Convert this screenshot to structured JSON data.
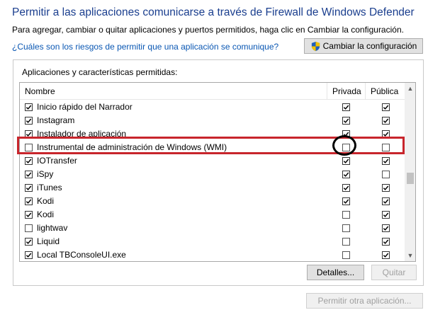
{
  "header": {
    "title": "Permitir a las aplicaciones comunicarse a través de Firewall de Windows Defender",
    "subtitle": "Para agregar, cambiar o quitar aplicaciones y puertos permitidos, haga clic en Cambiar la configuración.",
    "risk_link": "¿Cuáles son los riesgos de permitir que una aplicación se comunique?",
    "change_settings_label": "Cambiar la configuración"
  },
  "apps_group": {
    "label": "Aplicaciones y características permitidas:",
    "columns": {
      "name": "Nombre",
      "private": "Privada",
      "public": "Pública"
    },
    "rows": [
      {
        "name": "Inicio rápido del Narrador",
        "enabled": true,
        "private": true,
        "public": true
      },
      {
        "name": "Instagram",
        "enabled": true,
        "private": true,
        "public": true
      },
      {
        "name": "Instalador de aplicación",
        "enabled": true,
        "private": true,
        "public": true
      },
      {
        "name": "Instrumental de administración de Windows (WMI)",
        "enabled": false,
        "private": false,
        "public": false
      },
      {
        "name": "IOTransfer",
        "enabled": true,
        "private": true,
        "public": true
      },
      {
        "name": "iSpy",
        "enabled": true,
        "private": true,
        "public": false
      },
      {
        "name": "iTunes",
        "enabled": true,
        "private": true,
        "public": true
      },
      {
        "name": "Kodi",
        "enabled": true,
        "private": true,
        "public": true
      },
      {
        "name": "Kodi",
        "enabled": true,
        "private": false,
        "public": true
      },
      {
        "name": "lightwav",
        "enabled": false,
        "private": false,
        "public": true
      },
      {
        "name": "Liquid",
        "enabled": true,
        "private": false,
        "public": true
      },
      {
        "name": "Local TBConsoleUI.exe",
        "enabled": true,
        "private": false,
        "public": true
      }
    ],
    "details_label": "Detalles...",
    "remove_label": "Quitar"
  },
  "footer": {
    "allow_other_label": "Permitir otra aplicación..."
  },
  "icons": {
    "shield": "uac-shield-icon",
    "scroll_up": "chevron-up-icon",
    "scroll_down": "chevron-down-icon"
  },
  "colors": {
    "title": "#1a3e8e",
    "link": "#0a57b3",
    "highlight": "#c8252c"
  }
}
